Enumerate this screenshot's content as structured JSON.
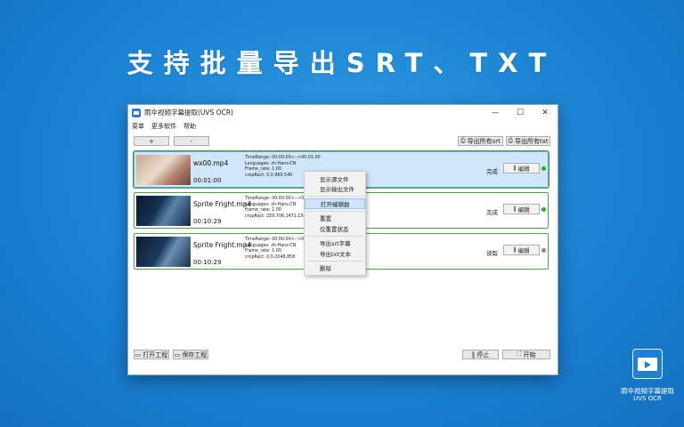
{
  "headline": "支持批量导出SRT、TXT",
  "window": {
    "title": "雨伞视频字幕提取(UVS OCR)",
    "min_glyph": "—",
    "max_glyph": "☐",
    "close_glyph": "✕"
  },
  "menu": [
    "菜单",
    "更多软件",
    "帮助"
  ],
  "toolbar": {
    "add_label": "+",
    "remove_label": "-",
    "export_srt_label": "导出所有srt",
    "export_txt_label": "导出所有txt"
  },
  "items": [
    {
      "filename": "wx00.mp4",
      "duration": "00:01:00",
      "meta": [
        "TimeRange: 00:00:00<-->00:01:00",
        "Languages: zh-Hans-CN",
        "Frame_rate: 1.00",
        "cropRect: 0,0,960,540"
      ],
      "status": "完成",
      "edit_label": "编辑",
      "dot_color": "#1db31d"
    },
    {
      "filename": "Sprite Fright.mp4",
      "duration": "00:10:29",
      "meta": [
        "TimeRange: 00:00:00<-->00:10:29",
        "Languages: zh-Hans-CN",
        "Frame_rate: 1.00",
        "cropRect: 259,706,1471,154"
      ],
      "status": "完成",
      "edit_label": "编辑",
      "dot_color": "#1db31d"
    },
    {
      "filename": "Sprite Fright.mp4",
      "duration": "00:10:29",
      "meta": [
        "TimeRange: 00:00:00<-->00:10:29",
        "Languages: zh-Hans-CN",
        "Frame_rate: 1.00",
        "cropRect: 0,0,2048,858"
      ],
      "status": "读取",
      "edit_label": "编辑",
      "dot_color": "#8a8a8a"
    }
  ],
  "context_menu": [
    "显示源文件",
    "显示输出文件",
    "打开编辑器",
    "重置",
    "仅重置状态",
    "导出srt字幕",
    "导出txt文本",
    "删除"
  ],
  "bottom": {
    "open_project": "打开工程",
    "save_project": "保存工程",
    "stop": "停止",
    "start": "开始"
  },
  "logo": {
    "line1": "雨伞视频字幕提取",
    "line2": "UVS OCR"
  }
}
